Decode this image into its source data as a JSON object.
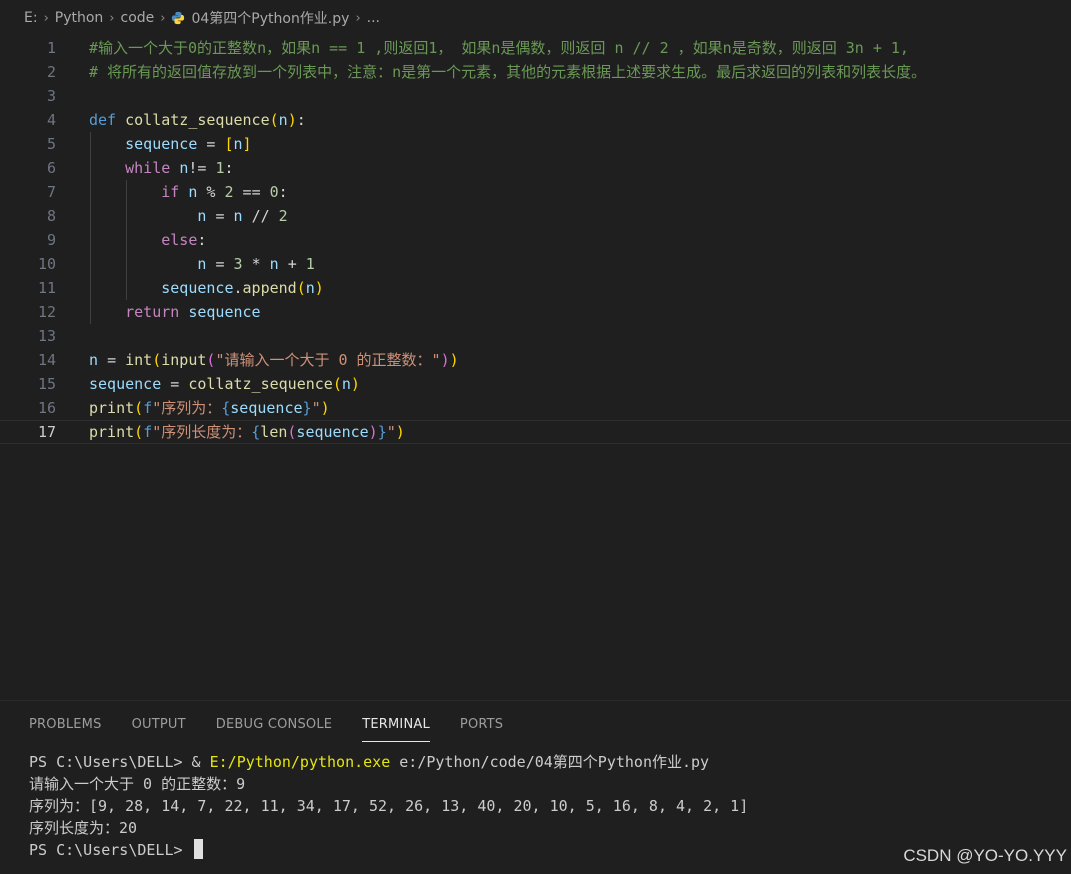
{
  "breadcrumb": {
    "items": [
      "E:",
      "Python",
      "code"
    ],
    "file": "04第四个Python作业.py",
    "more": "..."
  },
  "editor": {
    "current_line": 17,
    "lines": [
      {
        "n": "1",
        "text": "#输入一个大于0的正整数n，如果n == 1 ,则返回1， 如果n是偶数，则返回 n // 2 ，如果n是奇数，则返回 3n + 1,"
      },
      {
        "n": "2",
        "text": "# 将所有的返回值存放到一个列表中，注意：n是第一个元素，其他的元素根据上述要求生成。最后求返回的列表和列表长度。"
      },
      {
        "n": "3",
        "text": ""
      },
      {
        "n": "4",
        "text": "def collatz_sequence(n):"
      },
      {
        "n": "5",
        "text": "    sequence = [n]"
      },
      {
        "n": "6",
        "text": "    while n!= 1:"
      },
      {
        "n": "7",
        "text": "        if n % 2 == 0:"
      },
      {
        "n": "8",
        "text": "            n = n // 2"
      },
      {
        "n": "9",
        "text": "        else:"
      },
      {
        "n": "10",
        "text": "            n = 3 * n + 1"
      },
      {
        "n": "11",
        "text": "        sequence.append(n)"
      },
      {
        "n": "12",
        "text": "    return sequence"
      },
      {
        "n": "13",
        "text": ""
      },
      {
        "n": "14",
        "text": "n = int(input(\"请输入一个大于 0 的正整数：\"))"
      },
      {
        "n": "15",
        "text": "sequence = collatz_sequence(n)"
      },
      {
        "n": "16",
        "text": "print(f\"序列为：{sequence}\")"
      },
      {
        "n": "17",
        "text": "print(f\"序列长度为：{len(sequence)}\")"
      }
    ]
  },
  "panel": {
    "tabs": [
      "PROBLEMS",
      "OUTPUT",
      "DEBUG CONSOLE",
      "TERMINAL",
      "PORTS"
    ],
    "active_tab": "TERMINAL"
  },
  "terminal": {
    "line1_prompt": "PS C:\\Users\\DELL> & ",
    "line1_exe": "E:/Python/python.exe",
    "line1_arg": " e:/Python/code/04第四个Python作业.py",
    "line2": "请输入一个大于 0 的正整数：9",
    "line3": "序列为：[9, 28, 14, 7, 22, 11, 34, 17, 52, 26, 13, 40, 20, 10, 5, 16, 8, 4, 2, 1]",
    "line4": "序列长度为：20",
    "line5_prompt": "PS C:\\Users\\DELL> "
  },
  "watermark": "CSDN @YO-YO.YYY",
  "colors": {
    "keyword": "#569cd6",
    "control": "#c586c0",
    "function": "#dcdcaa",
    "variable": "#9cdcfe",
    "number": "#b5cea8",
    "string": "#ce9178",
    "comment": "#6a9955"
  }
}
